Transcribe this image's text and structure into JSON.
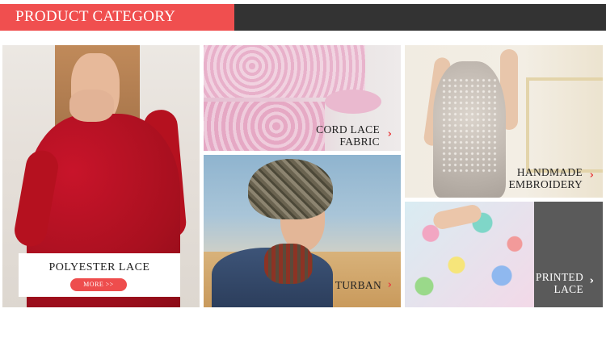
{
  "header": {
    "title": "PRODUCT CATEGORY",
    "accent_color": "#f04f4f",
    "bar_color": "#333333"
  },
  "tiles": {
    "polyester": {
      "label": "POLYESTER LACE",
      "button": "MORE  >>",
      "image": "red-lace-dress-photo"
    },
    "cord": {
      "line1": "CORD LACE",
      "line2": "FABRIC",
      "image": "pink-lace-fabric-photo"
    },
    "turban": {
      "label": "TURBAN",
      "image": "turban-model-photo"
    },
    "embroidery": {
      "line1": "HANDMADE",
      "line2": "EMBROIDERY",
      "image": "embroidered-gown-photo"
    },
    "printed": {
      "line1": "PRINTED",
      "line2": "LACE",
      "image": "printed-lace-skirt-photo"
    }
  },
  "icons": {
    "arrow": "›"
  }
}
